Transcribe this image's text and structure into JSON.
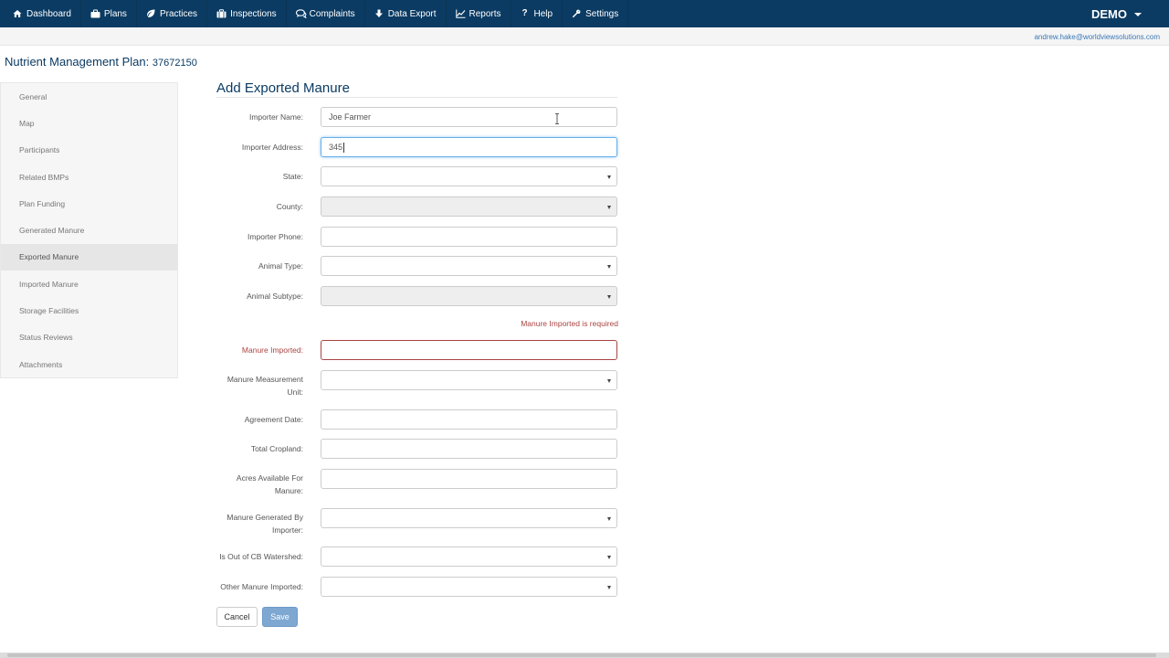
{
  "nav": {
    "items": [
      {
        "label": "Dashboard",
        "icon": "home-icon"
      },
      {
        "label": "Plans",
        "icon": "briefcase-icon"
      },
      {
        "label": "Practices",
        "icon": "leaf-icon"
      },
      {
        "label": "Inspections",
        "icon": "suitcase-icon"
      },
      {
        "label": "Complaints",
        "icon": "comments-icon"
      },
      {
        "label": "Data Export",
        "icon": "download-icon"
      },
      {
        "label": "Reports",
        "icon": "line-chart-icon"
      },
      {
        "label": "Help",
        "icon": "question-icon"
      },
      {
        "label": "Settings",
        "icon": "wrench-icon"
      }
    ],
    "brand": "DEMO"
  },
  "user": {
    "email": "andrew.hake@worldviewsolutions.com"
  },
  "page": {
    "title": "Nutrient Management Plan:",
    "plan_number": "37672150"
  },
  "sidebar": {
    "items": [
      {
        "label": "General"
      },
      {
        "label": "Map"
      },
      {
        "label": "Participants"
      },
      {
        "label": "Related BMPs"
      },
      {
        "label": "Plan Funding"
      },
      {
        "label": "Generated Manure"
      },
      {
        "label": "Exported Manure"
      },
      {
        "label": "Imported Manure"
      },
      {
        "label": "Storage Facilities"
      },
      {
        "label": "Status Reviews"
      },
      {
        "label": "Attachments"
      }
    ],
    "active_index": 6
  },
  "form": {
    "title": "Add Exported Manure",
    "importer_name": {
      "label": "Importer Name:",
      "value": "Joe Farmer"
    },
    "importer_address": {
      "label": "Importer Address:",
      "value": "345"
    },
    "state": {
      "label": "State:",
      "value": ""
    },
    "county": {
      "label": "County:",
      "value": ""
    },
    "importer_phone": {
      "label": "Importer Phone:",
      "value": ""
    },
    "animal_type": {
      "label": "Animal Type:",
      "value": ""
    },
    "animal_subtype": {
      "label": "Animal Subtype:",
      "value": ""
    },
    "manure_imported_error": "Manure Imported is required",
    "manure_imported": {
      "label": "Manure Imported:",
      "value": ""
    },
    "manure_measurement_unit": {
      "label_line1": "Manure Measurement",
      "label_line2": "Unit:",
      "value": ""
    },
    "agreement_date": {
      "label": "Agreement Date:",
      "value": ""
    },
    "total_cropland": {
      "label": "Total Cropland:",
      "value": ""
    },
    "acres_available": {
      "label_line1": "Acres Available For",
      "label_line2": "Manure:",
      "value": ""
    },
    "manure_generated_by_importer": {
      "label_line1": "Manure Generated By",
      "label_line2": "Importer:",
      "value": ""
    },
    "out_of_cb_watershed": {
      "label": "Is Out of CB Watershed:",
      "value": ""
    },
    "other_manure_imported": {
      "label": "Other Manure Imported:",
      "value": ""
    },
    "cancel_label": "Cancel",
    "save_label": "Save"
  }
}
